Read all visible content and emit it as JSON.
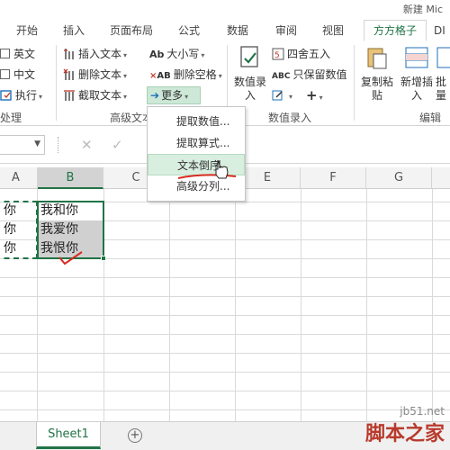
{
  "window": {
    "title": "新建 Mic"
  },
  "tabs": [
    {
      "label": "开始",
      "active": false
    },
    {
      "label": "插入",
      "active": false
    },
    {
      "label": "页面布局",
      "active": false
    },
    {
      "label": "公式",
      "active": false
    },
    {
      "label": "数据",
      "active": false
    },
    {
      "label": "审阅",
      "active": false
    },
    {
      "label": "视图",
      "active": false
    },
    {
      "label": "方方格子",
      "active": true
    },
    {
      "label": "DI",
      "active": false
    }
  ],
  "ribbon": {
    "group1": {
      "items": [
        "英文",
        "中文",
        "执行"
      ],
      "label": "处理"
    },
    "group2": {
      "insert_text": "插入文本",
      "delete_text": "删除文本",
      "extract_text": "截取文本",
      "case": "大小写",
      "delete_space": "删除空格",
      "more": "更多",
      "label": "高级文本"
    },
    "group3": {
      "value_input": [
        "数值录",
        "入"
      ],
      "round": "四舍五入",
      "keep_values": "只保留数值",
      "label": "数值录入"
    },
    "group4": {
      "copy_paste": [
        "复制粘",
        "贴"
      ],
      "add_insert": [
        "新增插",
        "入"
      ],
      "batch": [
        "批",
        "量"
      ],
      "label": "编辑"
    }
  },
  "menu": {
    "items": [
      {
        "label": "提取数值...",
        "hover": false
      },
      {
        "label": "提取算式...",
        "hover": false
      },
      {
        "label": "文本倒序",
        "hover": true
      },
      {
        "label": "高级分列...",
        "hover": false
      }
    ]
  },
  "formula_bar": {
    "cancel": "✕",
    "confirm": "✓"
  },
  "columns": [
    "A",
    "B",
    "C",
    "D",
    "E",
    "F",
    "G"
  ],
  "cells": {
    "col_a": [
      "你",
      "你",
      "你"
    ],
    "col_b": [
      "我和你",
      "我爱你",
      "我恨你"
    ]
  },
  "sheets": {
    "active": "Sheet1",
    "add": "+"
  },
  "watermark": {
    "url": "jb51.net",
    "name": "脚本之家"
  },
  "colors": {
    "accent": "#217346",
    "highlight": "#cde8d6"
  }
}
